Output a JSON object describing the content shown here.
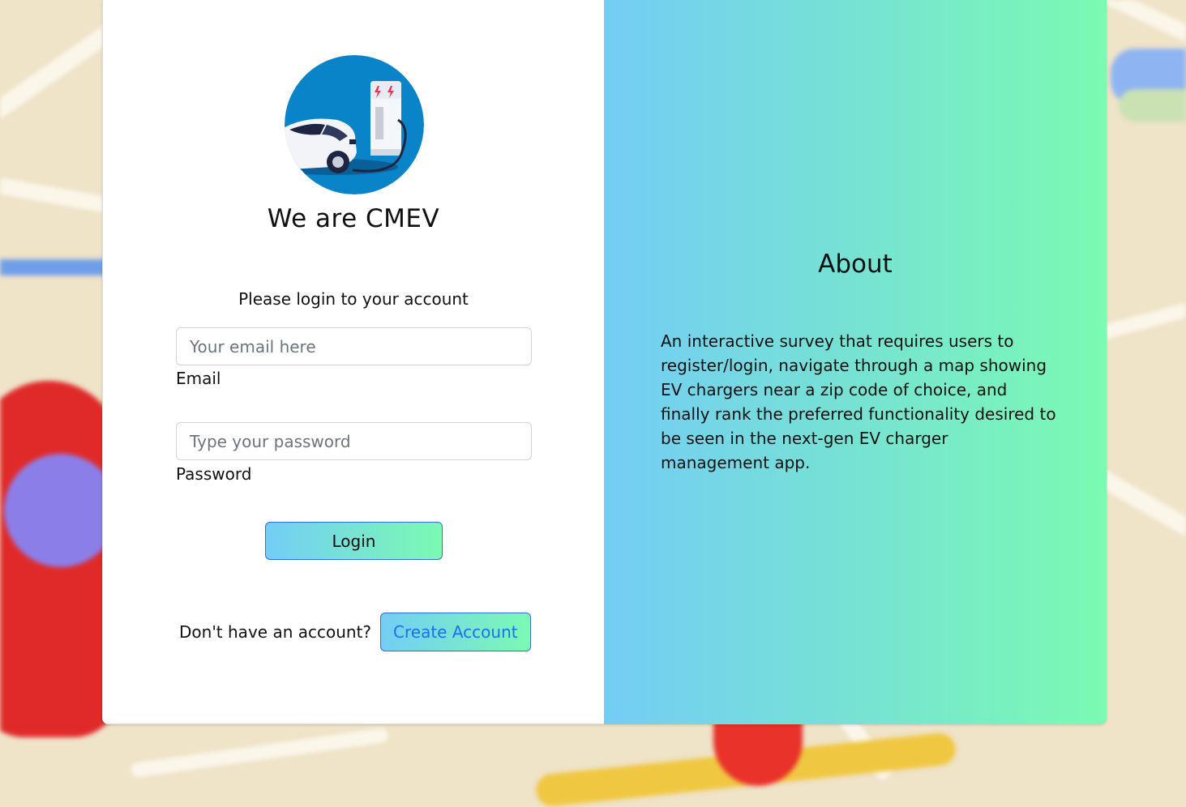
{
  "brand": {
    "title": "We are CMEV",
    "logo_icon": "ev-charging-car-icon"
  },
  "login": {
    "prompt": "Please login to your account",
    "email": {
      "placeholder": "Your email here",
      "value": "",
      "label": "Email"
    },
    "password": {
      "placeholder": "Type your password",
      "value": "",
      "label": "Password"
    },
    "submit_label": "Login",
    "signup_prompt": "Don't have an account?",
    "signup_label": "Create Account"
  },
  "about": {
    "title": "About",
    "description": "An interactive survey that requires users to register/login, navigate through a map showing EV chargers near a zip code of choice, and finally rank the preferred functionality desired to be seen in the next-gen EV charger management app."
  },
  "colors": {
    "gradient_start": "#74cdf5",
    "gradient_end": "#7bfab2",
    "button_border": "#2f6fe0",
    "link_text": "#1b6ff0",
    "logo_circle": "#0a84c8"
  }
}
